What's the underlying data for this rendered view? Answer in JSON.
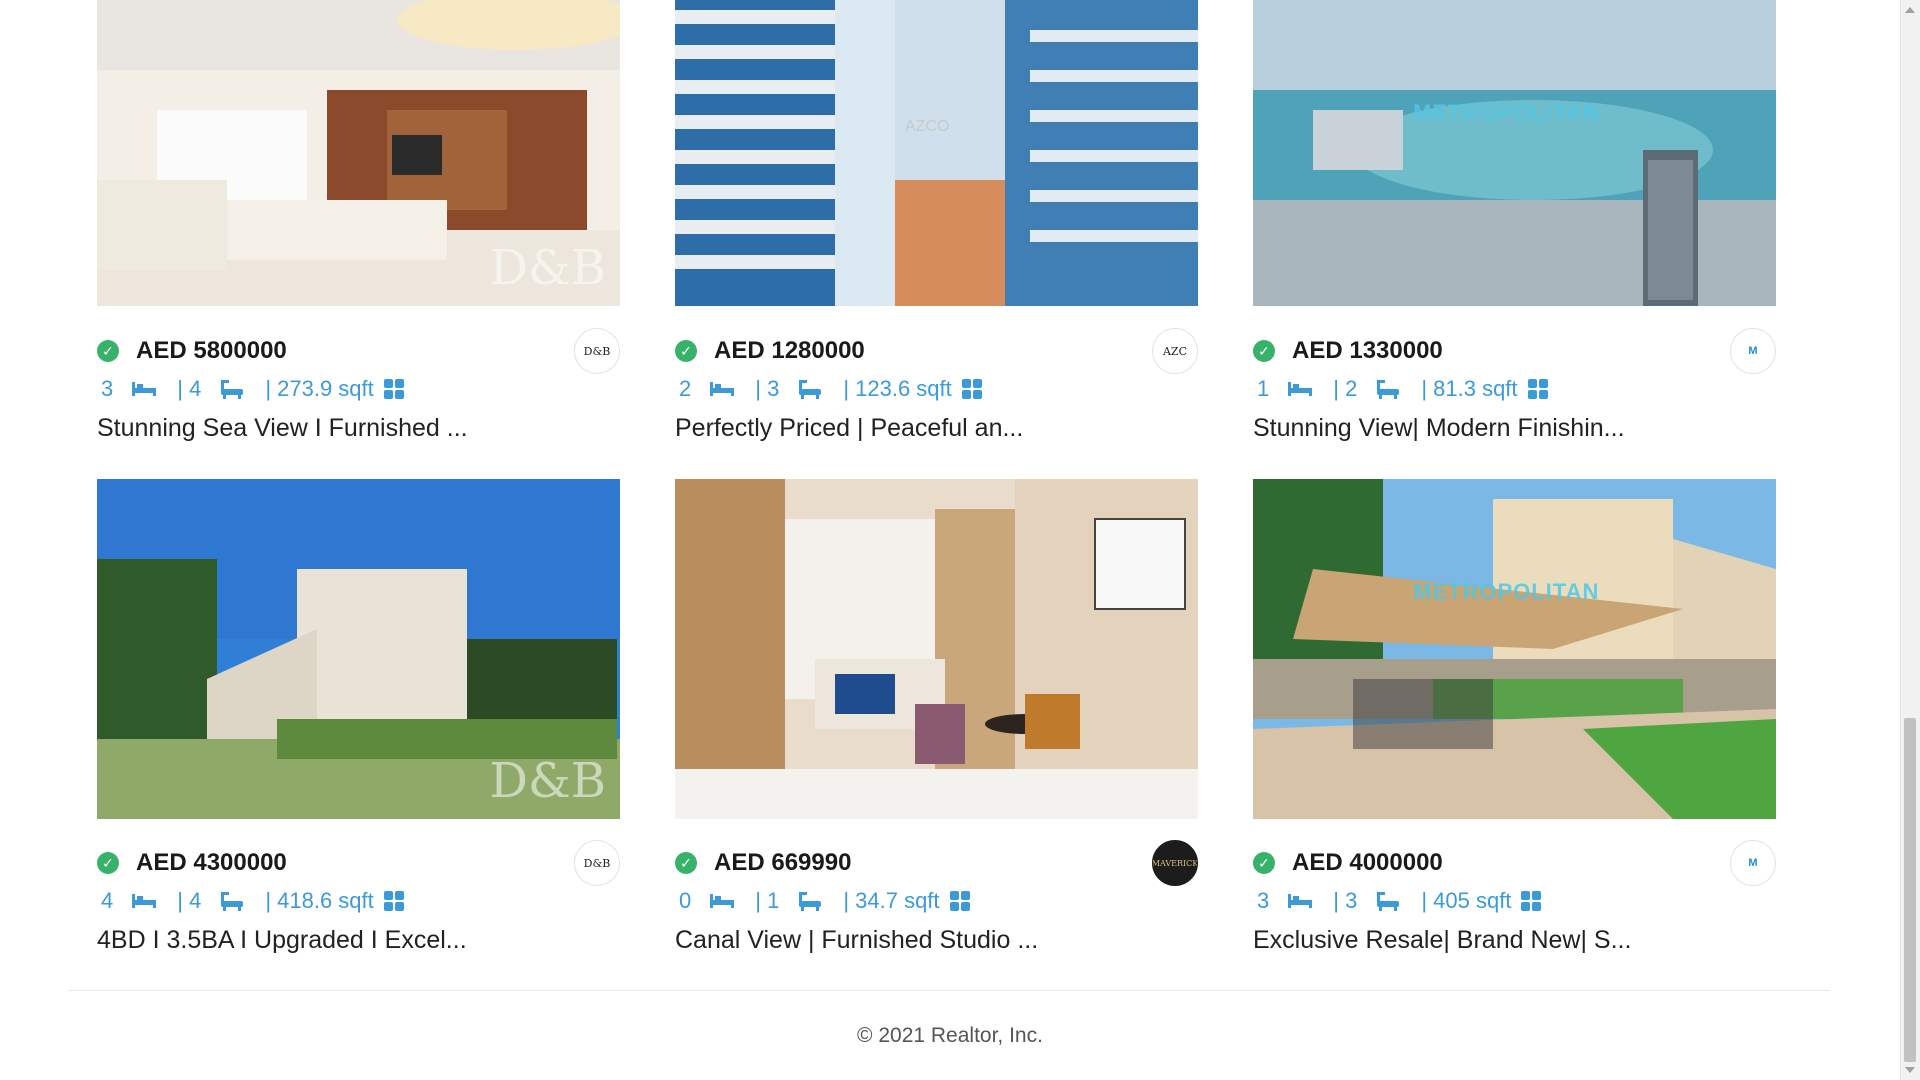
{
  "listings": [
    {
      "price": "AED 5800000",
      "beds": "3",
      "baths": "| 4",
      "area": "| 273.9 sqft",
      "title": "Stunning Sea View I Furnished ...",
      "agency_logo": "D&B",
      "watermark": "D&B"
    },
    {
      "price": "AED 1280000",
      "beds": "2",
      "baths": "| 3",
      "area": "| 123.6 sqft",
      "title": "Perfectly Priced | Peaceful an...",
      "agency_logo": "AZC",
      "watermark": "AZCO"
    },
    {
      "price": "AED 1330000",
      "beds": "1",
      "baths": "| 2",
      "area": "| 81.3 sqft",
      "title": "Stunning View| Modern Finishin...",
      "agency_logo": "M",
      "watermark": "METROPOLITAN"
    },
    {
      "price": "AED 4300000",
      "beds": "4",
      "baths": "| 4",
      "area": "| 418.6 sqft",
      "title": "4BD I 3.5BA I Upgraded I Excel...",
      "agency_logo": "D&B",
      "watermark": "D&B"
    },
    {
      "price": "AED 669990",
      "beds": "0",
      "baths": "| 1",
      "area": "| 34.7 sqft",
      "title": "Canal View | Furnished Studio ...",
      "agency_logo": "MAVERICK",
      "watermark": ""
    },
    {
      "price": "AED 4000000",
      "beds": "3",
      "baths": "| 3",
      "area": "| 405 sqft",
      "title": "Exclusive Resale| Brand New| S...",
      "agency_logo": "M",
      "watermark": "METROPOLITAN"
    }
  ],
  "icons": {
    "verified": "check-circle-icon",
    "bed": "bed-icon",
    "bath": "bathtub-icon",
    "more": "grid-icon"
  },
  "colors": {
    "accent": "#3c9ad6",
    "verified": "#38b26b"
  },
  "footer": {
    "copyright": "© 2021 Realtor, Inc."
  }
}
